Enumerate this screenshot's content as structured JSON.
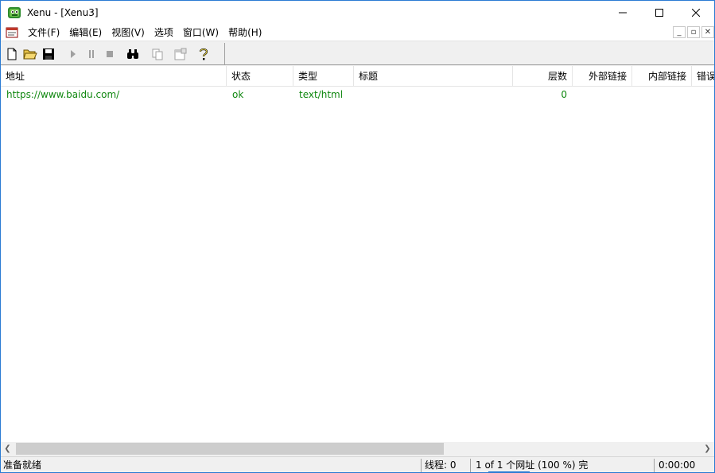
{
  "window": {
    "title": "Xenu - [Xenu3]"
  },
  "menu": {
    "items": [
      "文件(F)",
      "编辑(E)",
      "视图(V)",
      "选项",
      "窗口(W)",
      "帮助(H)"
    ]
  },
  "toolbar": {
    "buttons": [
      "new-icon",
      "open-folder-icon",
      "save-icon",
      "play-icon",
      "pause-icon",
      "stop-icon",
      "binoculars-icon",
      "copy-icon",
      "properties-icon",
      "help-icon"
    ]
  },
  "list": {
    "columns": [
      "地址",
      "状态",
      "类型",
      "标题",
      "层数",
      "外部链接",
      "内部链接",
      "错误"
    ],
    "rows": [
      {
        "address": "https://www.baidu.com/",
        "status": "ok",
        "type": "text/html",
        "title": "",
        "depth": "0",
        "external": "",
        "internal": "",
        "errors": ""
      }
    ],
    "row_color": "#118811"
  },
  "status": {
    "ready": "准备就绪",
    "threads": "线程: 0",
    "progress": "1 of 1 个网址 (100 %) 完",
    "time": "0:00:00"
  }
}
